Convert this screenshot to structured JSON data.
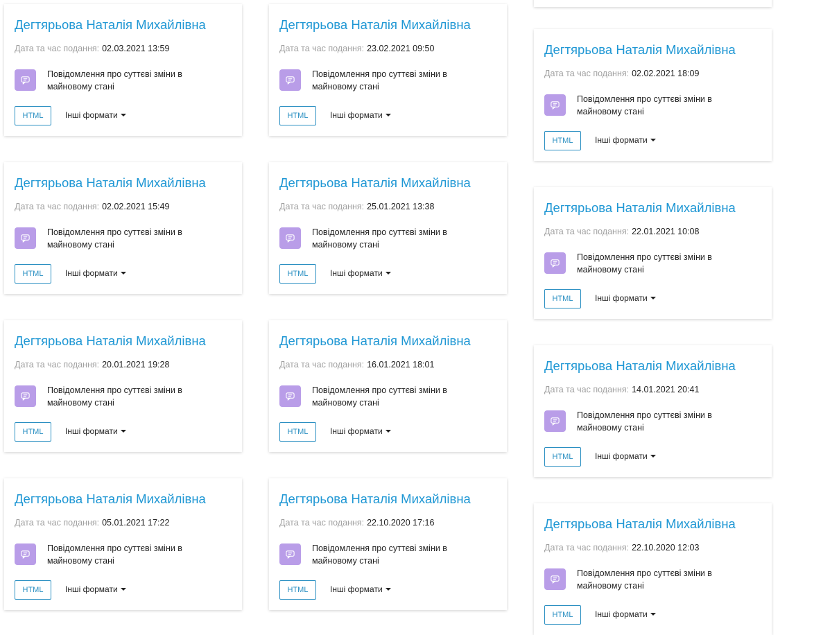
{
  "theme": {
    "title_color": "#1f97d4",
    "icon_bg": "#b99de8",
    "button_border": "#2a8fc2"
  },
  "labels": {
    "date_label": "Дата та час подання:",
    "doc_type": "Повідомлення про суттєві зміни в майновому стані",
    "html_button": "HTML",
    "other_formats": "Інші формати"
  },
  "columns": [
    {
      "cards": [
        {
          "name": "Дегтярьова Наталія Михайлівна",
          "date": "02.03.2021 13:59"
        },
        {
          "name": "Дегтярьова Наталія Михайлівна",
          "date": "02.02.2021 15:49"
        },
        {
          "name": "Дегтярьова Наталія Михайлівна",
          "date": "20.01.2021 19:28"
        },
        {
          "name": "Дегтярьова Наталія Михайлівна",
          "date": "05.01.2021 17:22"
        }
      ]
    },
    {
      "cards": [
        {
          "name": "Дегтярьова Наталія Михайлівна",
          "date": "23.02.2021 09:50"
        },
        {
          "name": "Дегтярьова Наталія Михайлівна",
          "date": "25.01.2021 13:38"
        },
        {
          "name": "Дегтярьова Наталія Михайлівна",
          "date": "16.01.2021 18:01"
        },
        {
          "name": "Дегтярьова Наталія Михайлівна",
          "date": "22.10.2020 17:16"
        }
      ]
    },
    {
      "cards": [
        {
          "name": "Дегтярьова Наталія Михайлівна",
          "date": "02.02.2021 18:09"
        },
        {
          "name": "Дегтярьова Наталія Михайлівна",
          "date": "22.01.2021 10:08"
        },
        {
          "name": "Дегтярьова Наталія Михайлівна",
          "date": "14.01.2021 20:41"
        },
        {
          "name": "Дегтярьова Наталія Михайлівна",
          "date": "22.10.2020 12:03"
        }
      ]
    }
  ]
}
